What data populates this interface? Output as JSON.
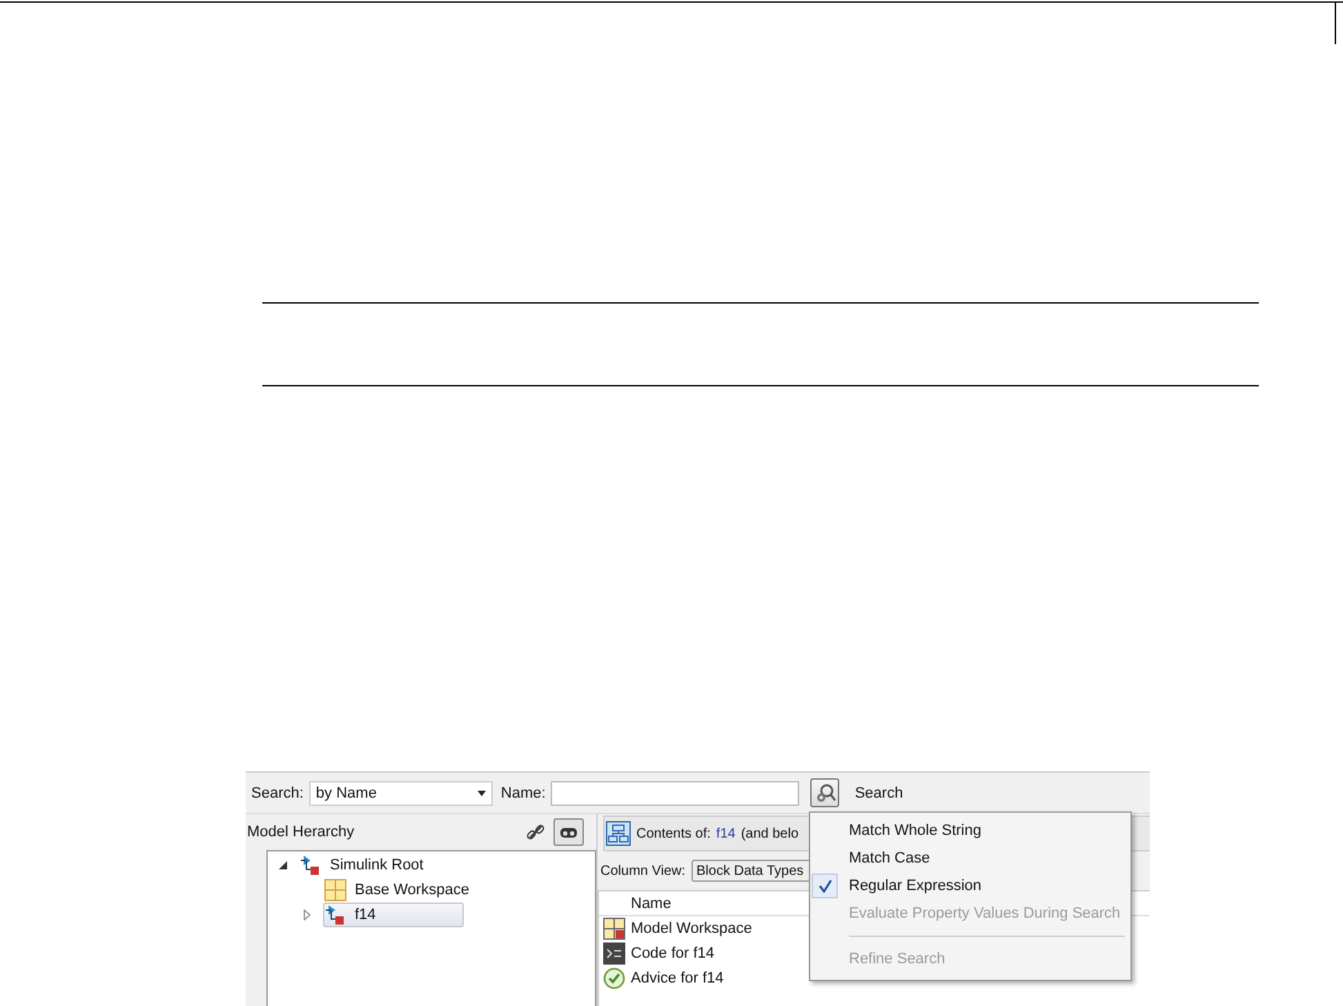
{
  "search_bar": {
    "search_label": "Search:",
    "search_by": "by Name",
    "name_label": "Name:",
    "search_button": "Search"
  },
  "hierarchy": {
    "title": "Model Herarchy",
    "tree": [
      {
        "label": "Simulink Root",
        "kind": "model",
        "expanded": true,
        "selected": false,
        "children": [
          {
            "label": "Base Workspace",
            "kind": "workspace",
            "selected": false
          },
          {
            "label": "f14",
            "kind": "model",
            "expanded": false,
            "selected": true
          }
        ]
      }
    ]
  },
  "contents": {
    "label": "Contents of:",
    "model": "f14",
    "suffix": "(and belo",
    "column_view_label": "Column View:",
    "column_view": "Block Data Types",
    "columns": [
      "Name"
    ],
    "rows": [
      {
        "name": "Model Workspace",
        "kind": "workspace"
      },
      {
        "name": "Code for f14",
        "kind": "code"
      },
      {
        "name": "Advice for f14",
        "kind": "advice"
      }
    ]
  },
  "search_menu": {
    "items": [
      {
        "kind": "option",
        "label": "Match Whole String",
        "checked": false,
        "disabled": false
      },
      {
        "kind": "option",
        "label": "Match Case",
        "checked": false,
        "disabled": false
      },
      {
        "kind": "option",
        "label": "Regular Expression",
        "checked": true,
        "disabled": false
      },
      {
        "kind": "option",
        "label": "Evaluate Property Values During Search",
        "checked": false,
        "disabled": true
      },
      {
        "kind": "separator"
      },
      {
        "kind": "option",
        "label": "Refine Search",
        "checked": false,
        "disabled": true
      }
    ]
  }
}
